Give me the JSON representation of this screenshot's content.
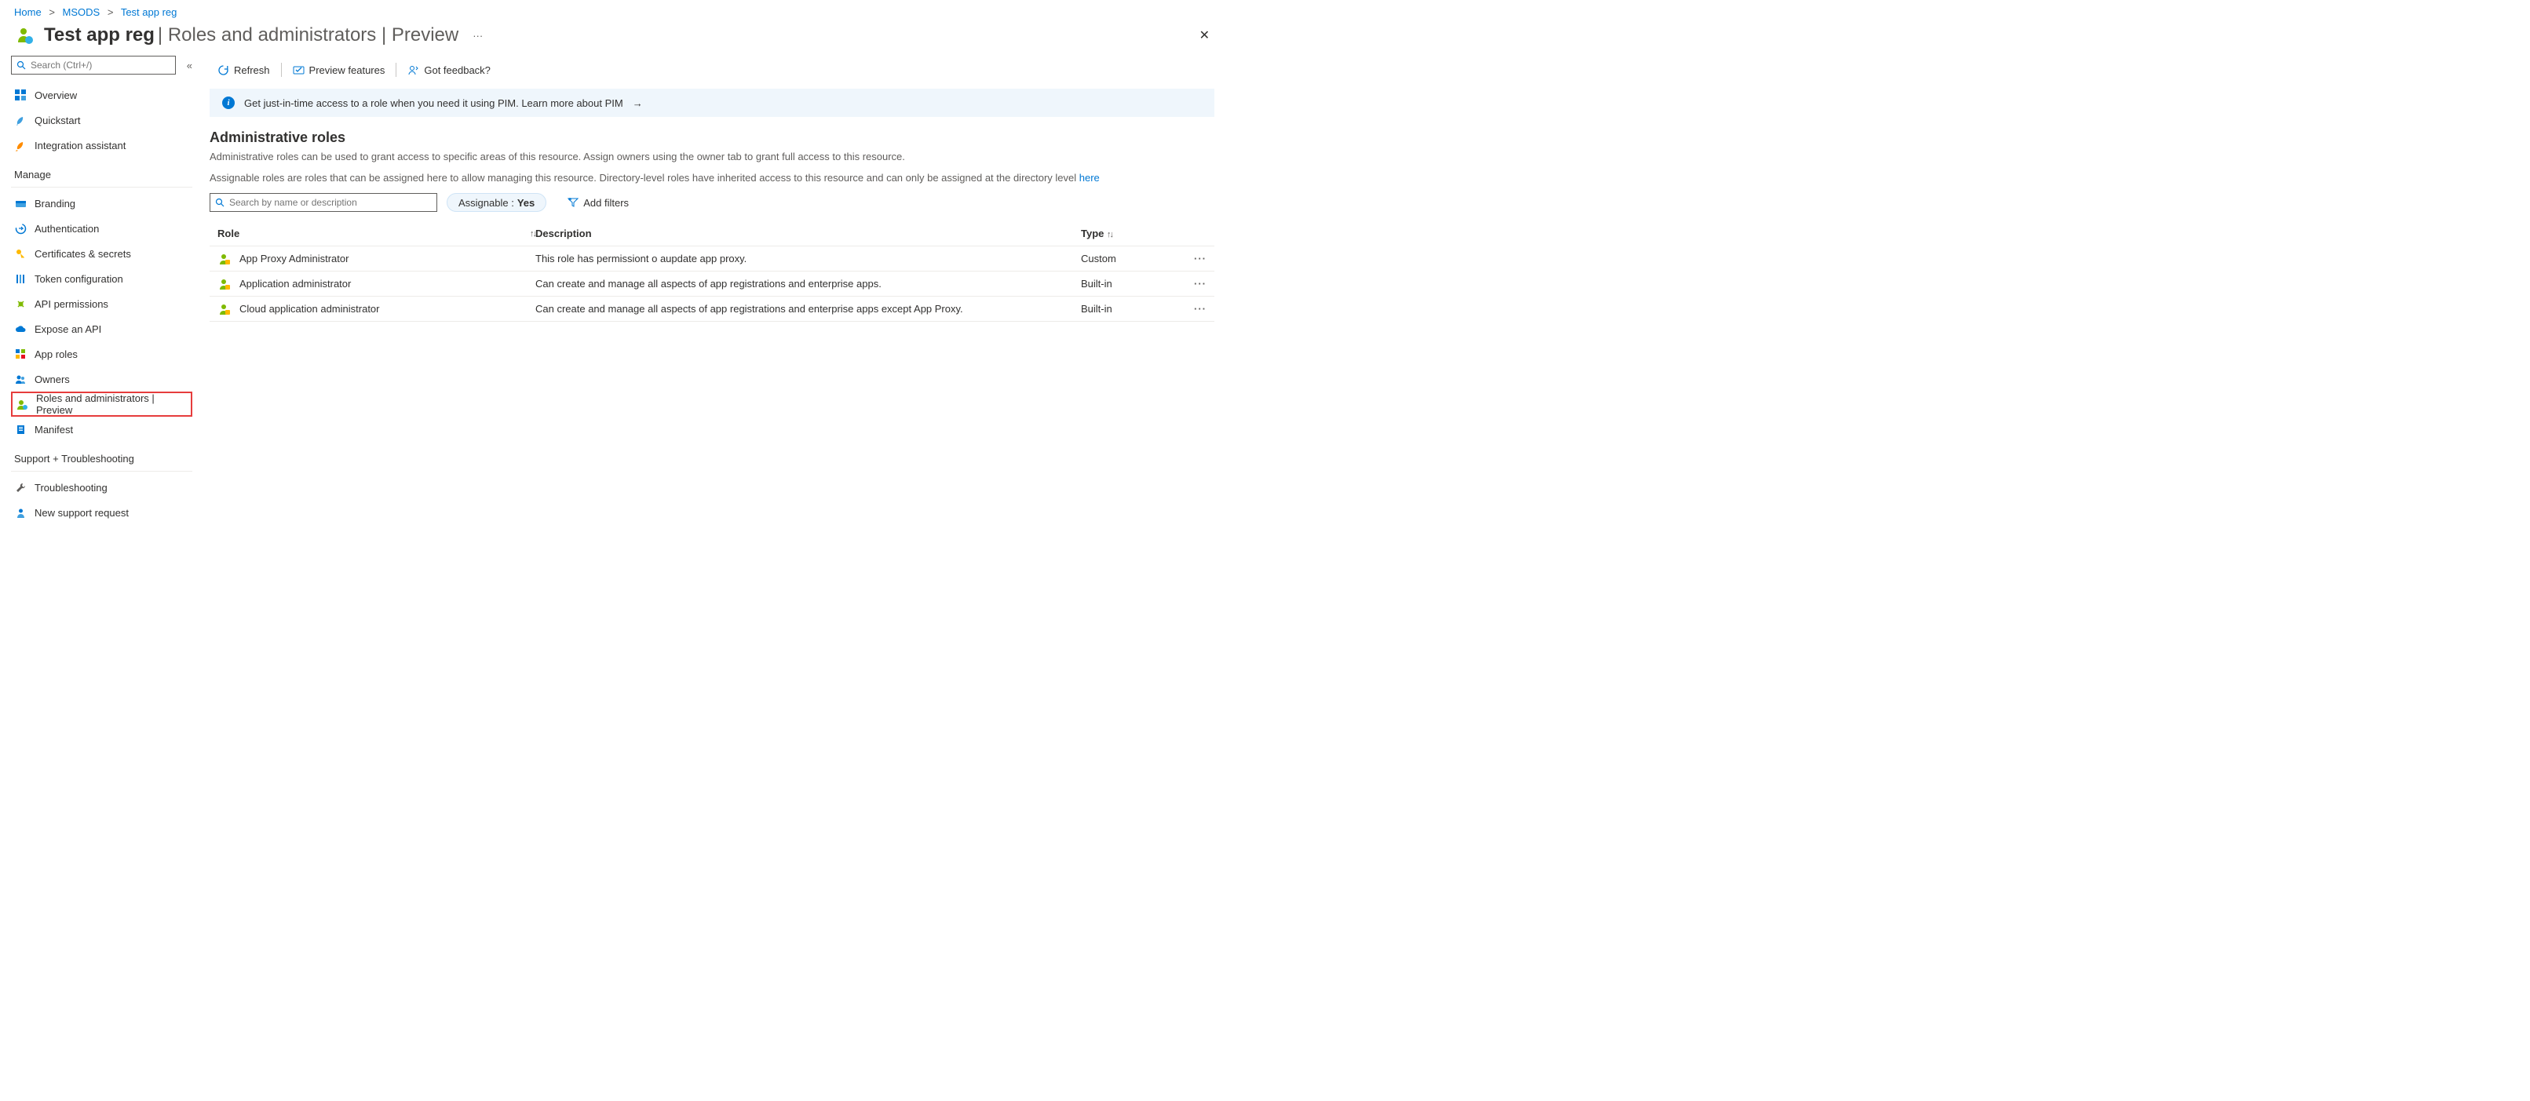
{
  "breadcrumb": [
    {
      "label": "Home"
    },
    {
      "label": "MSODS"
    },
    {
      "label": "Test app reg"
    }
  ],
  "header": {
    "title": "Test app reg",
    "subtitle": "| Roles and administrators | Preview"
  },
  "sidebar": {
    "search_placeholder": "Search (Ctrl+/)",
    "top": [
      {
        "label": "Overview"
      },
      {
        "label": "Quickstart"
      },
      {
        "label": "Integration assistant"
      }
    ],
    "section_manage": "Manage",
    "manage": [
      {
        "label": "Branding"
      },
      {
        "label": "Authentication"
      },
      {
        "label": "Certificates & secrets"
      },
      {
        "label": "Token configuration"
      },
      {
        "label": "API permissions"
      },
      {
        "label": "Expose an API"
      },
      {
        "label": "App roles"
      },
      {
        "label": "Owners"
      },
      {
        "label": "Roles and administrators | Preview",
        "selected": true
      },
      {
        "label": "Manifest"
      }
    ],
    "section_support": "Support + Troubleshooting",
    "support": [
      {
        "label": "Troubleshooting"
      },
      {
        "label": "New support request"
      }
    ]
  },
  "toolbar": {
    "refresh": "Refresh",
    "preview": "Preview features",
    "feedback": "Got feedback?"
  },
  "info_banner": {
    "text": "Get just-in-time access to a role when you need it using PIM. Learn more about PIM"
  },
  "section": {
    "title": "Administrative roles",
    "text1": "Administrative roles can be used to grant access to specific areas of this resource. Assign owners using the owner tab to grant full access to this resource.",
    "text2_a": "Assignable roles are roles that can be assigned here to allow managing this resource. Directory-level roles have inherited access to this resource and can only be assigned at the directory level ",
    "text2_link": "here"
  },
  "filter": {
    "search_placeholder": "Search by name or description",
    "assignable_label": "Assignable :",
    "assignable_value": "Yes",
    "add_filters": "Add filters"
  },
  "table": {
    "columns": {
      "role": "Role",
      "desc": "Description",
      "type": "Type"
    },
    "rows": [
      {
        "role": "App Proxy Administrator",
        "desc": "This role has permissiont o aupdate app proxy.",
        "type": "Custom"
      },
      {
        "role": "Application administrator",
        "desc": "Can create and manage all aspects of app registrations and enterprise apps.",
        "type": "Built-in"
      },
      {
        "role": "Cloud application administrator",
        "desc": "Can create and manage all aspects of app registrations and enterprise apps except App Proxy.",
        "type": "Built-in"
      }
    ]
  }
}
